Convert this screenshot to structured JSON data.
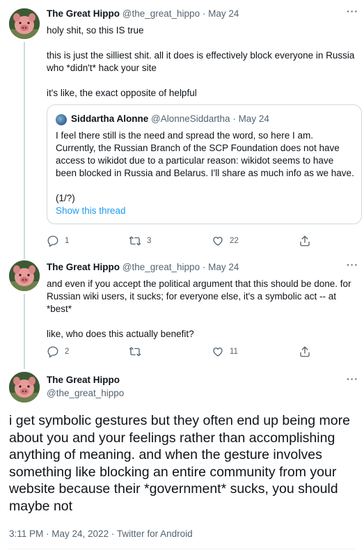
{
  "tweet1": {
    "name": "The Great Hippo",
    "handle": "@the_great_hippo",
    "sep": " · ",
    "date": "May 24",
    "lines": [
      "holy shit, so this IS true",
      "this is just the silliest shit. all it does is effectively block everyone in Russia who *didn't* hack your site",
      "it's like, the exact opposite of helpful"
    ],
    "quote": {
      "name": "Siddartha Alonne",
      "handle": "@AlonneSiddartha",
      "sep": " · ",
      "date": "May 24",
      "text": "I feel there still is the need and spread the word, so here I am. Currently, the Russian Branch of the SCP Foundation does not have access to wikidot due to a particular reason: wikidot seems to have been blocked in Russia and Belarus. I'll share as much info as we have.",
      "counter": "(1/?)",
      "link": "Show this thread"
    },
    "replies": "1",
    "retweets": "3",
    "likes": "22"
  },
  "tweet2": {
    "name": "The Great Hippo",
    "handle": "@the_great_hippo",
    "sep": " · ",
    "date": "May 24",
    "lines": [
      "and even if you accept the political argument that this should be done. for Russian wiki users, it sucks; for everyone else, it's a symbolic act -- at *best*",
      "like, who does this actually benefit?"
    ],
    "replies": "2",
    "retweets": "",
    "likes": "11"
  },
  "main": {
    "name": "The Great Hippo",
    "handle": "@the_great_hippo",
    "text": "i get symbolic gestures but they often end up being more about you and your feelings rather than accomplishing anything of meaning. and when the gesture involves something like blocking an entire community from your website because their *government* sucks, you should maybe not",
    "time": "3:11 PM · May 24, 2022 · Twitter for Android"
  },
  "more_glyph": "···",
  "icons": [
    "reply-icon",
    "retweet-icon",
    "like-icon",
    "share-icon",
    "more-icon"
  ],
  "colors": {
    "link": "#1d9bf0",
    "muted": "#536471",
    "border": "#cfd9de"
  }
}
